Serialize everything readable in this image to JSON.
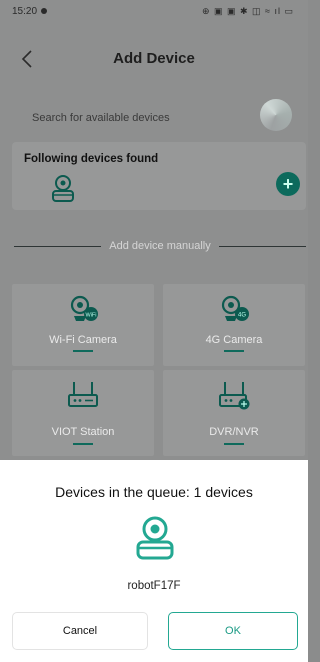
{
  "status_bar": {
    "time": "15:20",
    "icons": "⊕ ▣ ▣ ✱ ◫ ≈ ıl ▭"
  },
  "header": {
    "title": "Add Device"
  },
  "search": {
    "text": "Search for available devices"
  },
  "found": {
    "title": "Following devices found",
    "add_symbol": "+"
  },
  "manual": {
    "divider_label": "Add device manually",
    "tiles": [
      {
        "label": "Wi-Fi Camera",
        "badge": "WiFi"
      },
      {
        "label": "4G Camera",
        "badge": "4G"
      },
      {
        "label": "VIOT Station"
      },
      {
        "label": "DVR/NVR"
      }
    ]
  },
  "queue": {
    "title": "Devices in the queue: 1 devices",
    "device_name": "robotF17F",
    "cancel_label": "Cancel",
    "ok_label": "OK"
  },
  "colors": {
    "accent": "#23a892",
    "accent_dark": "#0c6a5c",
    "overlay": "#8e8f8f"
  }
}
